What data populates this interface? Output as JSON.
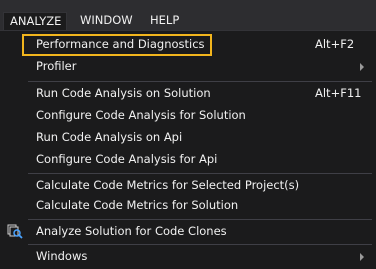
{
  "menubar": {
    "items": [
      {
        "label": "ANALYZE"
      },
      {
        "label": "WINDOW"
      },
      {
        "label": "HELP"
      }
    ]
  },
  "menu": {
    "items": [
      {
        "label": "Performance and Diagnostics",
        "shortcut": "Alt+F2"
      },
      {
        "label": "Profiler"
      },
      {
        "label": "Run Code Analysis on Solution",
        "shortcut": "Alt+F11"
      },
      {
        "label": "Configure Code Analysis for Solution"
      },
      {
        "label": "Run Code Analysis on Api"
      },
      {
        "label": "Configure Code Analysis for Api"
      },
      {
        "label": "Calculate Code Metrics for Selected Project(s)"
      },
      {
        "label": "Calculate Code Metrics for Solution"
      },
      {
        "label": "Analyze Solution for Code Clones"
      },
      {
        "label": "Windows"
      }
    ]
  },
  "colors": {
    "highlight_border": "#f2b51d",
    "menu_background": "#1b1b1c",
    "menubar_background": "#2d2d30"
  },
  "icons": {
    "submenu": "chevron-right-icon",
    "code_clones": "code-clones-icon"
  }
}
